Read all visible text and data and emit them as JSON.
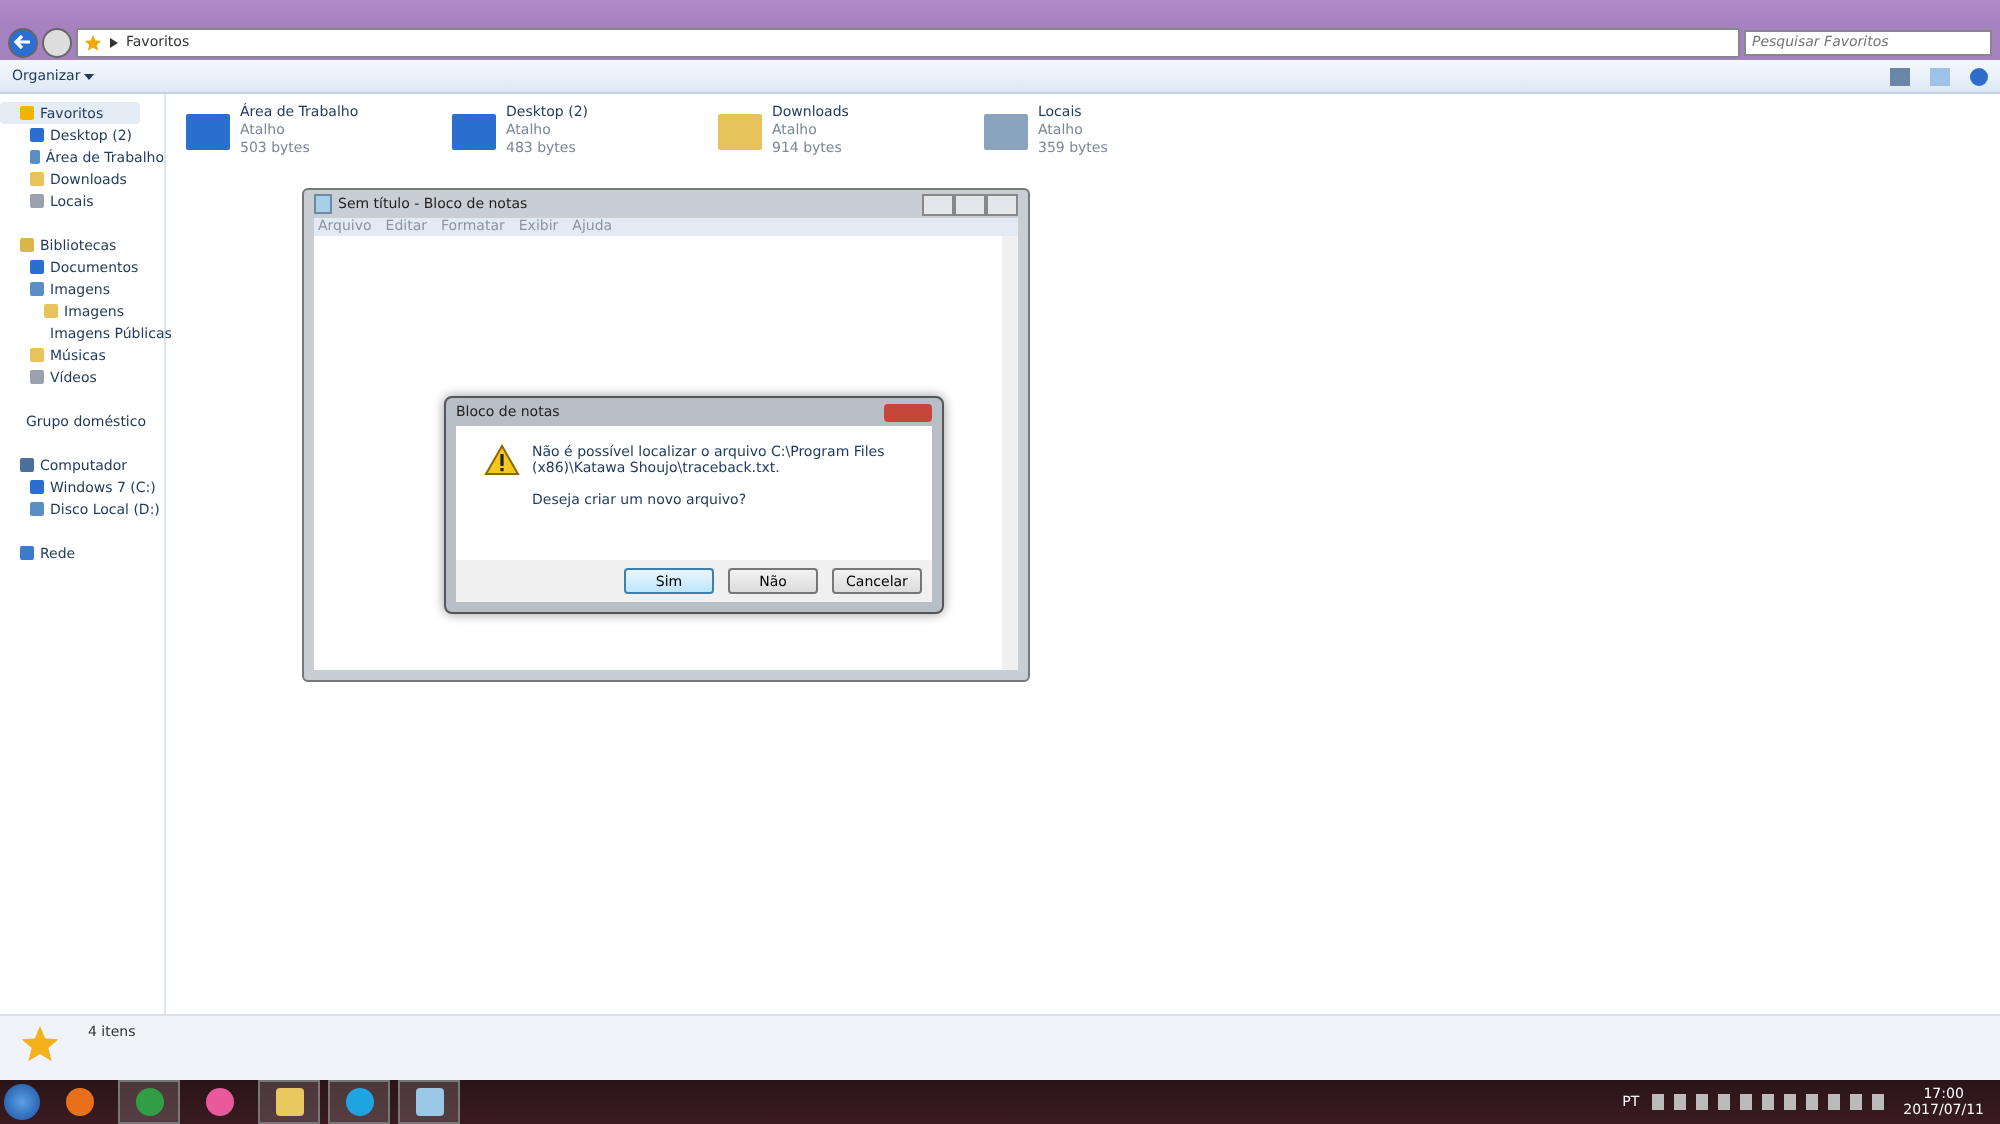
{
  "address_bar": {
    "path": "Favoritos",
    "search_placeholder": "Pesquisar Favoritos"
  },
  "toolbar": {
    "organize": "Organizar"
  },
  "sidebar": [
    {
      "label": "Favoritos",
      "selected": true,
      "children": [
        {
          "label": "Desktop (2)"
        },
        {
          "label": "Área de Trabalho"
        },
        {
          "label": "Downloads"
        },
        {
          "label": "Locais"
        }
      ]
    },
    {
      "label": "Bibliotecas",
      "selected": false,
      "children": [
        {
          "label": "Documentos"
        },
        {
          "label": "Imagens",
          "children": [
            {
              "label": "Imagens"
            },
            {
              "label": "Imagens Públicas"
            }
          ]
        },
        {
          "label": "Músicas"
        },
        {
          "label": "Vídeos"
        }
      ]
    },
    {
      "label": "Grupo doméstico",
      "selected": false
    },
    {
      "label": "Computador",
      "selected": false,
      "children": [
        {
          "label": "Windows 7 (C:)"
        },
        {
          "label": "Disco Local (D:)"
        }
      ]
    },
    {
      "label": "Rede",
      "selected": false
    }
  ],
  "files": [
    {
      "name": "Área de Trabalho",
      "type": "Atalho",
      "size": "503 bytes"
    },
    {
      "name": "Desktop (2)",
      "type": "Atalho",
      "size": "483 bytes"
    },
    {
      "name": "Downloads",
      "type": "Atalho",
      "size": "914 bytes"
    },
    {
      "name": "Locais",
      "type": "Atalho",
      "size": "359 bytes"
    }
  ],
  "status_bar": {
    "count": "4 itens"
  },
  "notepad": {
    "title": "Sem título - Bloco de notas",
    "menu": [
      "Arquivo",
      "Editar",
      "Formatar",
      "Exibir",
      "Ajuda"
    ]
  },
  "dialog": {
    "title": "Bloco de notas",
    "message": "Não é possível localizar o arquivo C:\\Program Files (x86)\\Katawa Shoujo\\traceback.txt.",
    "question": "Deseja criar um novo arquivo?",
    "buttons": [
      {
        "label": "Sim",
        "selected": true
      },
      {
        "label": "Não",
        "selected": false
      },
      {
        "label": "Cancelar",
        "selected": false
      }
    ]
  },
  "taskbar": {
    "apps": [
      {
        "kind": "firefox",
        "running": false
      },
      {
        "kind": "chrome",
        "running": true
      },
      {
        "kind": "osu",
        "running": false
      },
      {
        "kind": "explorer",
        "running": true
      },
      {
        "kind": "skype",
        "running": true
      },
      {
        "kind": "notepad",
        "running": true
      }
    ],
    "language": "PT",
    "time": "17:00",
    "date": "2017/07/11"
  }
}
